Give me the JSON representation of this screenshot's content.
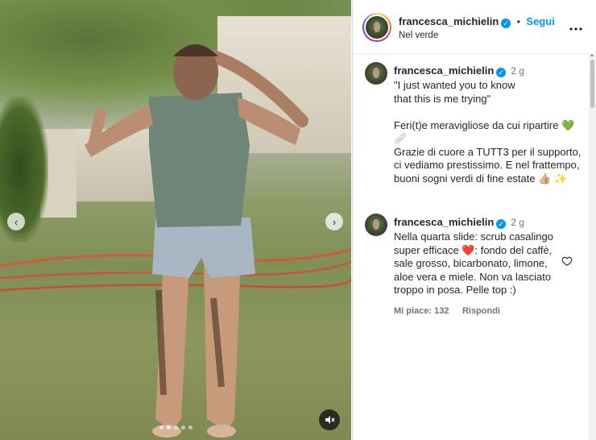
{
  "post": {
    "username": "francesca_michielin",
    "follow_label": "Segui",
    "separator": "•",
    "location": "Nel verde",
    "more_label": "•••"
  },
  "media": {
    "carousel_total": 5,
    "carousel_active": 1,
    "prev_arrow": "‹",
    "next_arrow": "›",
    "mute_icon": "🔇"
  },
  "caption": {
    "username": "francesca_michielin",
    "time": "2 g",
    "text": "\"I just wanted you to know\nthat this is me trying\"\n\nFeri(t)e meravigliose da cui ripartire 💚 🩹\nGrazie di cuore a TUTT3 per il supporto,\nci vediamo prestissimo. E nel frattempo,\nbuoni sogni verdi di fine estate 👍🏼 ✨"
  },
  "comment": {
    "username": "francesca_michielin",
    "time": "2 g",
    "text": "Nella quarta slide: scrub casalingo\nsuper efficace ❤️: fondo del caffè,\nsale grosso, bicarbonato, limone,\naloe vera e miele. Non va lasciato\ntroppo in posa. Pelle top :)",
    "likes_label": "Mi piace: 132",
    "reply_label": "Rispondi"
  },
  "colors": {
    "accent_blue": "#0095f6",
    "text": "#262626",
    "secondary": "#737373"
  }
}
